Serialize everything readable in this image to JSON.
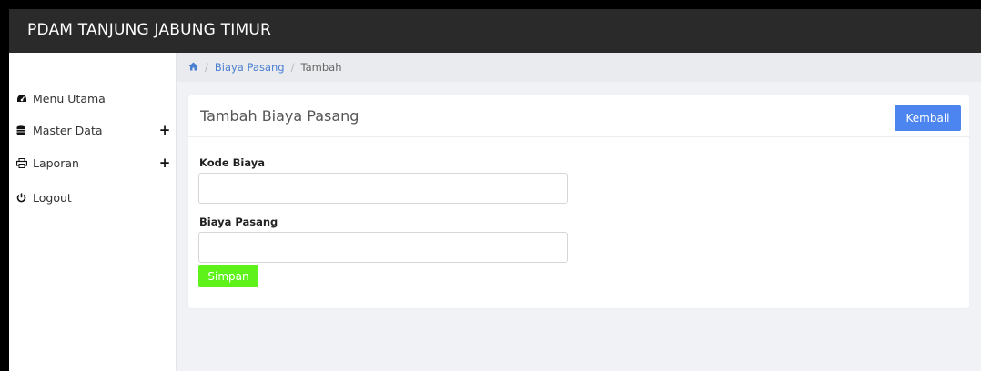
{
  "header": {
    "brand": "PDAM TANJUNG JABUNG TIMUR"
  },
  "sidebar": {
    "items": [
      {
        "label": "Menu Utama",
        "icon": "dashboard-icon",
        "expandable": false
      },
      {
        "label": "Master Data",
        "icon": "database-icon",
        "expandable": true
      },
      {
        "label": "Laporan",
        "icon": "print-icon",
        "expandable": true
      },
      {
        "label": "Logout",
        "icon": "power-icon",
        "expandable": false
      }
    ]
  },
  "breadcrumb": {
    "home_icon": "home-icon",
    "separator": "/",
    "link": "Biaya Pasang",
    "active": "Tambah"
  },
  "card": {
    "title": "Tambah Biaya Pasang",
    "back_label": "Kembali"
  },
  "form": {
    "kode_label": "Kode Biaya",
    "kode_value": "",
    "biaya_label": "Biaya Pasang",
    "biaya_value": "",
    "save_label": "Simpan"
  },
  "colors": {
    "topbar": "#2a2a2a",
    "primary": "#4c84f0",
    "success": "#5ef21a",
    "link": "#4b7fd1"
  }
}
